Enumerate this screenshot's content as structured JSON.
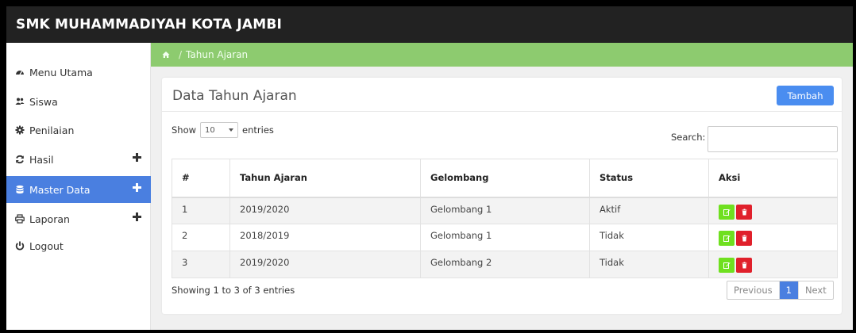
{
  "app": {
    "brand": "SMK MUHAMMADIYAH KOTA JAMBI"
  },
  "sidebar": {
    "items": [
      {
        "label": "Menu Utama",
        "icon": "dashboard-icon",
        "has_plus": false,
        "active": false
      },
      {
        "label": "Siswa",
        "icon": "users-icon",
        "has_plus": false,
        "active": false
      },
      {
        "label": "Penilaian",
        "icon": "gear-icon",
        "has_plus": false,
        "active": false
      },
      {
        "label": "Hasil",
        "icon": "refresh-icon",
        "has_plus": true,
        "active": false
      },
      {
        "label": "Master Data",
        "icon": "database-icon",
        "has_plus": true,
        "active": true
      },
      {
        "label": "Laporan",
        "icon": "print-icon",
        "has_plus": true,
        "active": false
      },
      {
        "label": "Logout",
        "icon": "power-icon",
        "has_plus": false,
        "active": false
      }
    ]
  },
  "breadcrumb": {
    "home_icon": "home-icon",
    "separator": "/",
    "current": "Tahun Ajaran"
  },
  "panel": {
    "title": "Data Tahun Ajaran",
    "add_button": "Tambah",
    "show_label": "Show",
    "entries_label": "entries",
    "page_length": "10",
    "search_label": "Search:",
    "search_value": ""
  },
  "table": {
    "headers": [
      "#",
      "Tahun Ajaran",
      "Gelombang",
      "Status",
      "Aksi"
    ],
    "rows": [
      {
        "no": "1",
        "tahun": "2019/2020",
        "gelombang": "Gelombang 1",
        "status": "Aktif"
      },
      {
        "no": "2",
        "tahun": "2018/2019",
        "gelombang": "Gelombang 1",
        "status": "Tidak"
      },
      {
        "no": "3",
        "tahun": "2019/2020",
        "gelombang": "Gelombang 2",
        "status": "Tidak"
      }
    ]
  },
  "footer": {
    "info": "Showing 1 to 3 of 3 entries",
    "previous": "Previous",
    "current_page": "1",
    "next": "Next"
  },
  "colors": {
    "navbar": "#222222",
    "active_menu": "#4a7fe0",
    "breadcrumb": "#8dcb6f",
    "add_button": "#4a8df0",
    "edit_button": "#6fe01f",
    "delete_button": "#e0202b"
  }
}
